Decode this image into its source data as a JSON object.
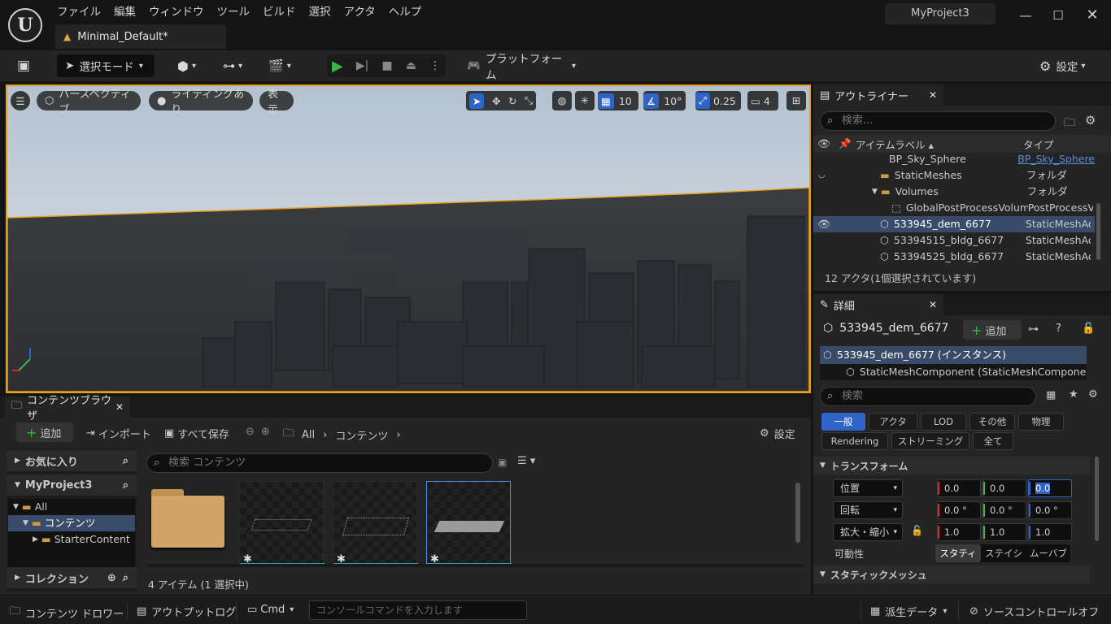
{
  "app": {
    "logo_text": "U",
    "menu": [
      "ファイル",
      "編集",
      "ウィンドウ",
      "ツール",
      "ビルド",
      "選択",
      "アクタ",
      "ヘルプ"
    ],
    "level_tab": "Minimal_Default*",
    "project_name": "MyProject3"
  },
  "toolbar": {
    "mode_label": "選択モード",
    "platform_label": "プラットフォーム",
    "settings_label": "設定"
  },
  "viewport": {
    "perspective_label": "パースペクティブ",
    "lighting_label": "ライティングあり",
    "show_label": "表示",
    "grid_snap": "10",
    "rotation_snap": "10°",
    "scale_snap": "0.25",
    "camera_speed": "4"
  },
  "outliner": {
    "tab_label": "アウトライナー",
    "search_placeholder": "検索...",
    "col_label": "アイテムラベル ▴",
    "col_type": "タイプ",
    "rows": [
      {
        "label": "BP_Sky_Sphere",
        "type": "BP_Sky_Sphere"
      },
      {
        "label": "StaticMeshes",
        "type": "フォルダ"
      },
      {
        "label": "Volumes",
        "type": "フォルダ"
      },
      {
        "label": "GlobalPostProcessVolume",
        "type": "PostProcessVolume"
      },
      {
        "label": "533945_dem_6677",
        "type": "StaticMeshActor"
      },
      {
        "label": "53394515_bldg_6677",
        "type": "StaticMeshActor"
      },
      {
        "label": "53394525_bldg_6677",
        "type": "StaticMeshActor"
      }
    ],
    "status": "12 アクタ(1個選択されています)"
  },
  "details": {
    "tab_label": "詳細",
    "actor_name": "533945_dem_6677",
    "add_label": "追加",
    "instance_label": "533945_dem_6677 (インスタンス)",
    "component_label": "StaticMeshComponent (StaticMeshComponent0)",
    "search_placeholder": "検索",
    "filters_row1": [
      "一般",
      "アクタ",
      "LOD",
      "その他",
      "物理"
    ],
    "filters_row2": [
      "Rendering",
      "ストリーミング",
      "全て"
    ],
    "transform_header": "トランスフォーム",
    "location_label": "位置",
    "rotation_label": "回転",
    "scale_label": "拡大・縮小",
    "location": [
      "0.0",
      "0.0",
      "0.0"
    ],
    "rotation": [
      "0.0 °",
      "0.0 °",
      "0.0 °"
    ],
    "scale": [
      "1.0",
      "1.0",
      "1.0"
    ],
    "mobility_label": "可動性",
    "mobility_options": [
      "スタティ",
      "ステイシ",
      "ムーバブ"
    ],
    "static_mesh_header": "スタティックメッシュ"
  },
  "content_browser": {
    "tab_label": "コンテンツブラウザ",
    "add_label": "追加",
    "import_label": "インポート",
    "save_all_label": "すべて保存",
    "path": [
      "All",
      "コンテンツ"
    ],
    "settings_label": "設定",
    "favorites_label": "お気に入り",
    "project_label": "MyProject3",
    "tree": [
      "All",
      "コンテンツ",
      "StarterContent"
    ],
    "collections_label": "コレクション",
    "search_placeholder": "検索 コンテンツ",
    "status": "4 アイテム (1 選択中)"
  },
  "statusbar": {
    "content_drawer": "コンテンツ ドロワー",
    "output_log": "アウトプットログ",
    "cmd_label": "Cmd",
    "console_placeholder": "コンソールコマンドを入力します",
    "derived_data": "派生データ",
    "source_control": "ソースコントロールオフ"
  },
  "colors": {
    "accent_blue": "#2e64c8",
    "selection_outline": "#e8a01a",
    "play_green": "#3cb44a"
  }
}
